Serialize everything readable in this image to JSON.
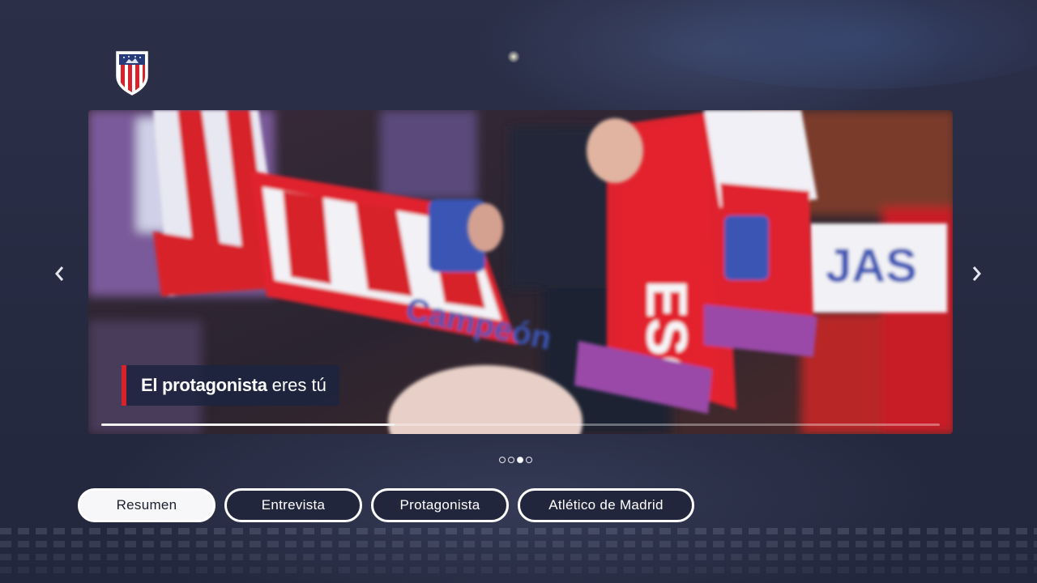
{
  "header": {
    "logo_icon": "atletico-madrid-crest-icon"
  },
  "carousel": {
    "caption_bold": "El protagonista",
    "caption_rest": "eres tú",
    "progress": 0.35,
    "prev_icon": "chevron-left-icon",
    "next_icon": "chevron-right-icon",
    "slide_count": 4,
    "active_slide": 3
  },
  "tabs": [
    {
      "label": "Resumen",
      "selected": true
    },
    {
      "label": "Entrevista",
      "selected": false
    },
    {
      "label": "Protagonista",
      "selected": false
    },
    {
      "label": "Atlético de Madrid",
      "selected": false
    }
  ],
  "colors": {
    "background": "#282c45",
    "accent_red": "#d8222b",
    "navy": "#1e2440"
  }
}
